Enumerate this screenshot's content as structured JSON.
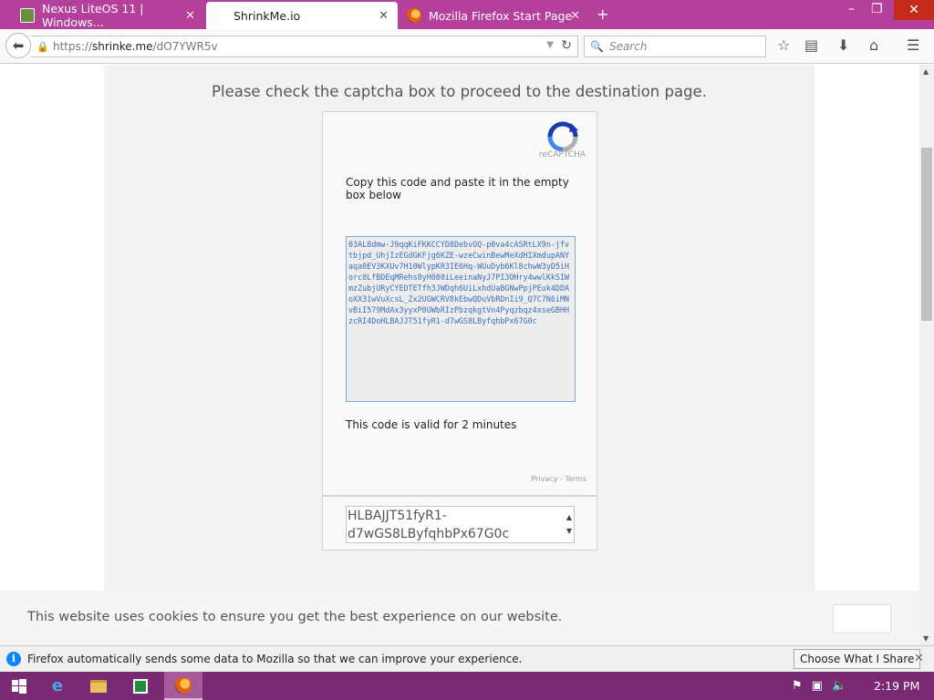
{
  "tabs": [
    {
      "label": "Nexus LiteOS 11 | Windows...",
      "icon": "nexus-icon"
    },
    {
      "label": "ShrinkMe.io",
      "icon": ""
    },
    {
      "label": "Mozilla Firefox Start Page",
      "icon": "firefox-icon"
    }
  ],
  "new_tab_symbol": "+",
  "window_controls": {
    "minimize": "–",
    "restore": "❐",
    "close": "✕"
  },
  "url": {
    "scheme": "https://",
    "host": "shrinke.me",
    "path": "/dO7YWR5v"
  },
  "search": {
    "placeholder": "Search"
  },
  "page": {
    "instruction": "Please check the captcha box to proceed to the destination page.",
    "recaptcha_label": "reCAPTCHA",
    "copy_prompt": "Copy this code and paste it in the empty box below",
    "code": "03AL8dmw-J9qqKiFKKCCYD8DebvOQ-p0va4cASRtLX9n-jfvtbjpd_UhjIzEGdGKFjg6KZE-wzeCwinBewMeXdHIXmdupANYaqa0EV3KXUv7H10WlypKR3IE6Hq-WUuDyb6Kl8chwW3yD5iHorc8LfBDEqMRehs8yH080iLeeinaNyJ7PI3OHry4wwlKkSIWmzZubjURyCYEDTETfh3JWDqh6UiLxhdUaBGNwPpjPEuk4DDAoXX31wVuXcsL_Zx2UGWCRV8kEbwQDuVbRDnIi9_Q7C7N6iMNvBiI579MdAx3yyxP8UWbRIzPbzqkgtVn4Pyqzbqz4xseGBHHzcRI4DoHLBAJJT51fyR1-d7wGS8LByfqhbPx67G0c",
    "valid_text": "This code is valid for 2 minutes",
    "privacy_terms": "Privacy - Terms",
    "answer_value": "HLBAJJT51fyR1-d7wGS8LByfqhbPx67G0c"
  },
  "cookie": {
    "text": "This website uses cookies to ensure you get the best experience on our website.",
    "button": ""
  },
  "notification": {
    "message": "Firefox automatically sends some data to Mozilla so that we can improve your experience.",
    "button": "Choose What I Share",
    "close": "✕"
  },
  "taskbar": {
    "clock": "2:19 PM"
  },
  "colors": {
    "tabstrip": "#b4409c",
    "taskbar": "#7a2a72",
    "info": "#0a84ff",
    "code": "#3a6fb8"
  }
}
